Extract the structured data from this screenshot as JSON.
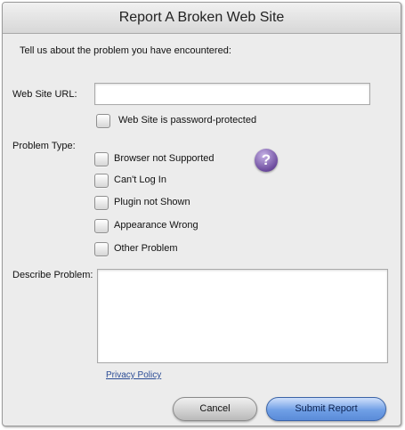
{
  "dialog": {
    "title": "Report A Broken Web Site",
    "intro": "Tell us about the problem you have encountered:"
  },
  "url": {
    "label": "Web Site URL:",
    "value": "",
    "password_protected_label": "Web Site is password-protected"
  },
  "problem": {
    "label": "Problem Type:",
    "options": [
      {
        "label": "Browser not Supported",
        "checked": false
      },
      {
        "label": "Can't Log In",
        "checked": false
      },
      {
        "label": "Plugin not Shown",
        "checked": false
      },
      {
        "label": "Appearance Wrong",
        "checked": false
      },
      {
        "label": "Other Problem",
        "checked": false
      }
    ],
    "help_glyph": "?"
  },
  "describe": {
    "label": "Describe Problem:",
    "value": ""
  },
  "privacy_link": "Privacy Policy",
  "buttons": {
    "cancel": "Cancel",
    "submit": "Submit Report"
  },
  "colors": {
    "accent": "#6f9fe6",
    "help_icon": "#6d4c9e",
    "link": "#2a4b95"
  }
}
